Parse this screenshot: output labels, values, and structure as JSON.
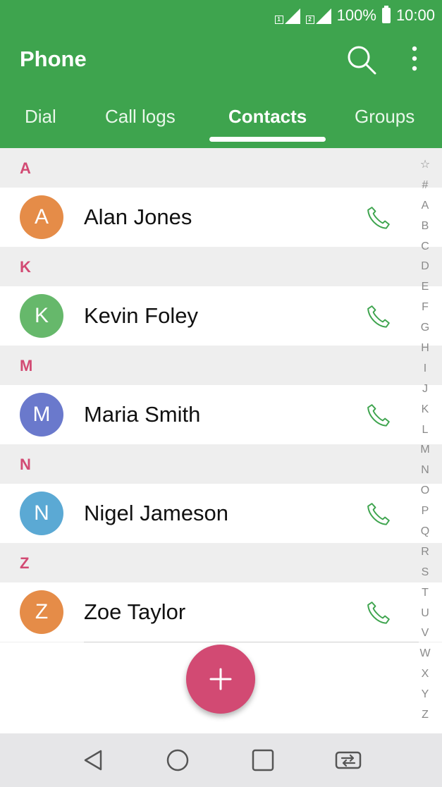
{
  "status_bar": {
    "battery": "100%",
    "time": "10:00",
    "sim1": "1",
    "sim2": "2"
  },
  "app_bar": {
    "title": "Phone"
  },
  "tabs": [
    {
      "label": "Dial",
      "active": false
    },
    {
      "label": "Call logs",
      "active": false
    },
    {
      "label": "Contacts",
      "active": true
    },
    {
      "label": "Groups",
      "active": false
    }
  ],
  "contacts": [
    {
      "section": "A",
      "name": "Alan Jones",
      "initial": "A",
      "avatar_color": "#e58c48"
    },
    {
      "section": "K",
      "name": "Kevin Foley",
      "initial": "K",
      "avatar_color": "#66b86b"
    },
    {
      "section": "M",
      "name": "Maria Smith",
      "initial": "M",
      "avatar_color": "#6a79cc"
    },
    {
      "section": "N",
      "name": "Nigel Jameson",
      "initial": "N",
      "avatar_color": "#5ba9d4"
    },
    {
      "section": "Z",
      "name": "Zoe Taylor",
      "initial": "Z",
      "avatar_color": "#e58c48"
    }
  ],
  "index_letters": [
    "☆",
    "#",
    "A",
    "B",
    "C",
    "D",
    "E",
    "F",
    "G",
    "H",
    "I",
    "J",
    "K",
    "L",
    "M",
    "N",
    "O",
    "P",
    "Q",
    "R",
    "S",
    "T",
    "U",
    "V",
    "W",
    "X",
    "Y",
    "Z"
  ],
  "colors": {
    "primary": "#3ea44e",
    "accent": "#d24a73",
    "call_icon": "#3ea44e"
  },
  "icons": {
    "search": "search-icon",
    "more": "more-vert-icon",
    "call": "phone-icon",
    "add": "plus-icon",
    "back": "back-icon",
    "home": "home-icon",
    "recents": "recents-icon",
    "switch_sim": "switch-icon"
  }
}
